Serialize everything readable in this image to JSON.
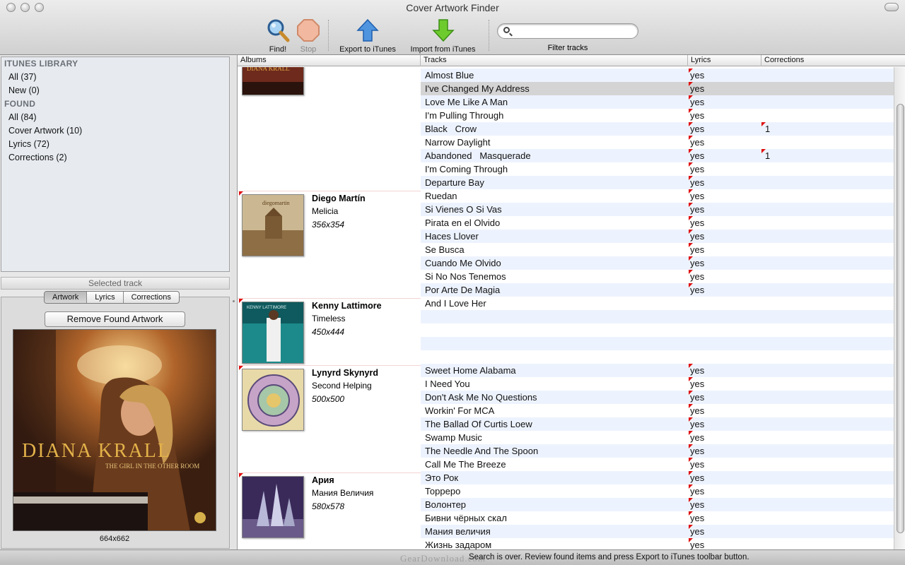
{
  "window": {
    "title": "Cover Artwork Finder"
  },
  "toolbar": {
    "find_label": "Find!",
    "stop_label": "Stop",
    "export_label": "Export to iTunes",
    "import_label": "Import from iTunes",
    "filter_label": "Filter tracks",
    "search_placeholder": "",
    "search_value": ""
  },
  "sidebar": {
    "sections": [
      {
        "header": "ITUNES LIBRARY",
        "items": [
          "All (37)",
          "New (0)"
        ]
      },
      {
        "header": "FOUND",
        "items": [
          "All (84)",
          "Cover Artwork (10)",
          "Lyrics (72)",
          "Corrections (2)"
        ]
      }
    ]
  },
  "detail": {
    "selected_label": "Selected track",
    "tabs": [
      "Artwork",
      "Lyrics",
      "Corrections"
    ],
    "active_tab": "Artwork",
    "remove_button": "Remove Found Artwork",
    "artwork": {
      "artist_text": "DIANA KRALL",
      "album_text": "THE GIRL IN THE OTHER ROOM"
    },
    "artwork_size": "664x662"
  },
  "table": {
    "columns": [
      "Albums",
      "Tracks",
      "Lyrics",
      "Corrections"
    ],
    "albums": [
      {
        "artist": "",
        "title": "",
        "size": ""
      },
      {
        "artist": "Diego Martín",
        "title": "Melicia",
        "size": "356x354"
      },
      {
        "artist": "Kenny Lattimore",
        "title": "Timeless",
        "size": "450x444"
      },
      {
        "artist": "Lynyrd Skynyrd",
        "title": "Second Helping",
        "size": "500x500"
      },
      {
        "artist": "Ария",
        "title": "Мания Величия",
        "size": "580x578"
      }
    ],
    "rows": [
      {
        "track": "Almost Blue",
        "lyrics": "yes",
        "corrections": ""
      },
      {
        "track": "I've Changed My Address",
        "lyrics": "yes",
        "corrections": ""
      },
      {
        "track": "Love Me Like A Man",
        "lyrics": "yes",
        "corrections": ""
      },
      {
        "track": "I'm Pulling Through",
        "lyrics": "yes",
        "corrections": ""
      },
      {
        "track": "Black   Crow",
        "lyrics": "yes",
        "corrections": "1"
      },
      {
        "track": "Narrow Daylight",
        "lyrics": "yes",
        "corrections": ""
      },
      {
        "track": "Abandoned   Masquerade",
        "lyrics": "yes",
        "corrections": "1"
      },
      {
        "track": "I'm Coming Through",
        "lyrics": "yes",
        "corrections": ""
      },
      {
        "track": "Departure Bay",
        "lyrics": "yes",
        "corrections": ""
      },
      {
        "track": "Ruedan",
        "lyrics": "yes",
        "corrections": ""
      },
      {
        "track": "Si Vienes O Si Vas",
        "lyrics": "yes",
        "corrections": ""
      },
      {
        "track": "Pirata en el Olvido",
        "lyrics": "yes",
        "corrections": ""
      },
      {
        "track": "Haces Llover",
        "lyrics": "yes",
        "corrections": ""
      },
      {
        "track": "Se Busca",
        "lyrics": "yes",
        "corrections": ""
      },
      {
        "track": "Cuando Me Olvido",
        "lyrics": "yes",
        "corrections": ""
      },
      {
        "track": "Si No Nos Tenemos",
        "lyrics": "yes",
        "corrections": ""
      },
      {
        "track": "Por Arte De Magia",
        "lyrics": "yes",
        "corrections": ""
      },
      {
        "track": "And I Love Her",
        "lyrics": "",
        "corrections": ""
      },
      {
        "track": "",
        "lyrics": "",
        "corrections": ""
      },
      {
        "track": "",
        "lyrics": "",
        "corrections": ""
      },
      {
        "track": "",
        "lyrics": "",
        "corrections": ""
      },
      {
        "track": "",
        "lyrics": "",
        "corrections": ""
      },
      {
        "track": "Sweet Home Alabama",
        "lyrics": "yes",
        "corrections": ""
      },
      {
        "track": "I Need You",
        "lyrics": "yes",
        "corrections": ""
      },
      {
        "track": "Don't Ask Me No Questions",
        "lyrics": "yes",
        "corrections": ""
      },
      {
        "track": "Workin' For MCA",
        "lyrics": "yes",
        "corrections": ""
      },
      {
        "track": "The Ballad Of Curtis Loew",
        "lyrics": "yes",
        "corrections": ""
      },
      {
        "track": "Swamp Music",
        "lyrics": "yes",
        "corrections": ""
      },
      {
        "track": "The Needle And The Spoon",
        "lyrics": "yes",
        "corrections": ""
      },
      {
        "track": "Call Me The Breeze",
        "lyrics": "yes",
        "corrections": ""
      },
      {
        "track": "Это Рок",
        "lyrics": "yes",
        "corrections": ""
      },
      {
        "track": "Торреро",
        "lyrics": "yes",
        "corrections": ""
      },
      {
        "track": "Волонтер",
        "lyrics": "yes",
        "corrections": ""
      },
      {
        "track": "Бивни чёрных скал",
        "lyrics": "yes",
        "corrections": ""
      },
      {
        "track": "Мания величия",
        "lyrics": "yes",
        "corrections": ""
      },
      {
        "track": "Жизнь задаром",
        "lyrics": "yes",
        "corrections": ""
      }
    ]
  },
  "status": {
    "message": "Search is over. Review found items and press Export to iTunes toolbar button.",
    "watermark": "GearDownload.com"
  },
  "colors": {
    "alt_row": "#edf3fe",
    "selected_row": "#d4d4d4",
    "flag": "#e01010",
    "sidebar_bg": "#e7ebf0"
  }
}
